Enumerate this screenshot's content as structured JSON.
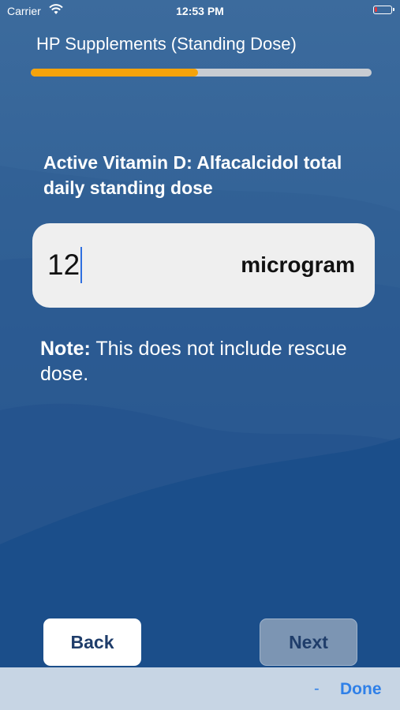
{
  "status_bar": {
    "carrier": "Carrier",
    "time": "12:53 PM"
  },
  "header": {
    "title": "HP Supplements (Standing Dose)",
    "progress_percent": 49
  },
  "question": {
    "text": "Active Vitamin D: Alfacalcidol total daily standing dose"
  },
  "dose_input": {
    "value": "12",
    "unit": "microgram"
  },
  "note": {
    "label": "Note:",
    "text": " This does not include rescue dose."
  },
  "buttons": {
    "back": "Back",
    "next": "Next"
  },
  "keyboard_toolbar": {
    "minus": "-",
    "done": "Done"
  },
  "colors": {
    "accent_progress": "#f5a30b",
    "background_blue": "#3b6a9e",
    "link_blue": "#2f80e8"
  }
}
